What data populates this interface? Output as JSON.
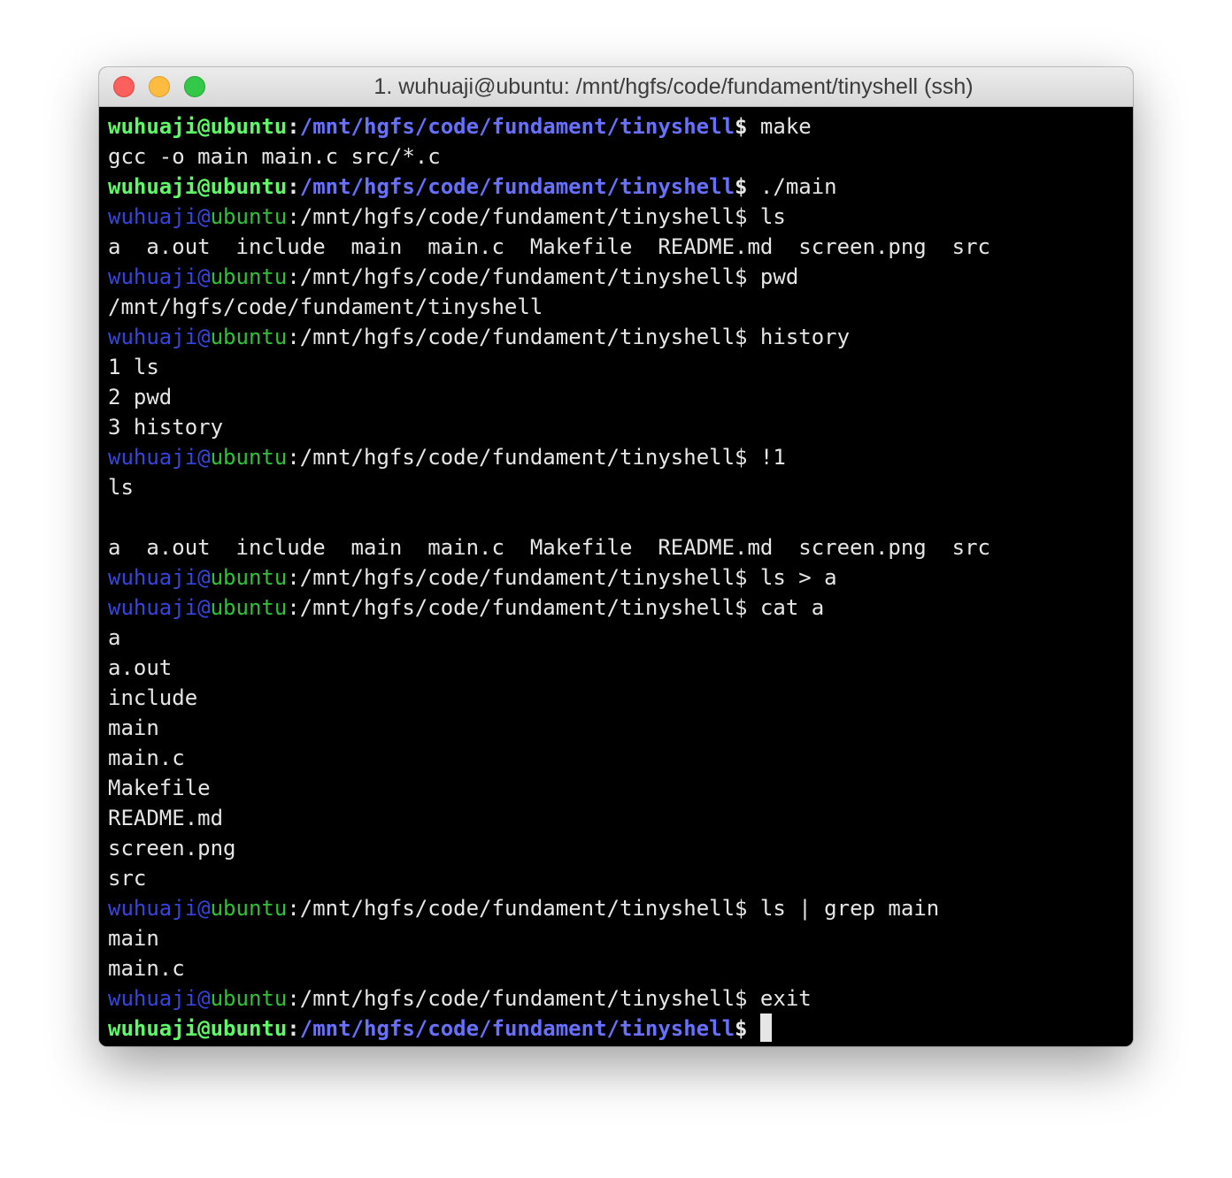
{
  "window": {
    "title": "1. wuhuaji@ubuntu: /mnt/hgfs/code/fundament/tinyshell (ssh)"
  },
  "colors": {
    "bold_user": "#5ff967",
    "bold_path": "#6871ff",
    "plain_user": "#3744e0",
    "plain_host": "#2fc238",
    "text": "#e6e6e6",
    "background": "#000000"
  },
  "terminal": {
    "lines": [
      {
        "type": "bold_prompt",
        "user": "wuhuaji@ubuntu",
        "path": "/mnt/hgfs/code/fundament/tinyshell",
        "cmd": " make"
      },
      {
        "type": "output",
        "text": "gcc -o main main.c src/*.c"
      },
      {
        "type": "bold_prompt",
        "user": "wuhuaji@ubuntu",
        "path": "/mnt/hgfs/code/fundament/tinyshell",
        "cmd": " ./main"
      },
      {
        "type": "plain_prompt",
        "user": "wuhuaji",
        "at": "@",
        "host": "ubuntu",
        "path": ":/mnt/hgfs/code/fundament/tinyshell$",
        "cmd": " ls"
      },
      {
        "type": "output",
        "text": "a  a.out  include  main  main.c  Makefile  README.md  screen.png  src"
      },
      {
        "type": "plain_prompt",
        "user": "wuhuaji",
        "at": "@",
        "host": "ubuntu",
        "path": ":/mnt/hgfs/code/fundament/tinyshell$",
        "cmd": " pwd"
      },
      {
        "type": "output",
        "text": "/mnt/hgfs/code/fundament/tinyshell"
      },
      {
        "type": "plain_prompt",
        "user": "wuhuaji",
        "at": "@",
        "host": "ubuntu",
        "path": ":/mnt/hgfs/code/fundament/tinyshell$",
        "cmd": " history"
      },
      {
        "type": "output",
        "text": "1 ls"
      },
      {
        "type": "output",
        "text": "2 pwd"
      },
      {
        "type": "output",
        "text": "3 history"
      },
      {
        "type": "plain_prompt",
        "user": "wuhuaji",
        "at": "@",
        "host": "ubuntu",
        "path": ":/mnt/hgfs/code/fundament/tinyshell$",
        "cmd": " !1"
      },
      {
        "type": "output",
        "text": "ls"
      },
      {
        "type": "output",
        "text": ""
      },
      {
        "type": "output",
        "text": "a  a.out  include  main  main.c  Makefile  README.md  screen.png  src"
      },
      {
        "type": "plain_prompt",
        "user": "wuhuaji",
        "at": "@",
        "host": "ubuntu",
        "path": ":/mnt/hgfs/code/fundament/tinyshell$",
        "cmd": " ls > a"
      },
      {
        "type": "plain_prompt",
        "user": "wuhuaji",
        "at": "@",
        "host": "ubuntu",
        "path": ":/mnt/hgfs/code/fundament/tinyshell$",
        "cmd": " cat a"
      },
      {
        "type": "output",
        "text": "a"
      },
      {
        "type": "output",
        "text": "a.out"
      },
      {
        "type": "output",
        "text": "include"
      },
      {
        "type": "output",
        "text": "main"
      },
      {
        "type": "output",
        "text": "main.c"
      },
      {
        "type": "output",
        "text": "Makefile"
      },
      {
        "type": "output",
        "text": "README.md"
      },
      {
        "type": "output",
        "text": "screen.png"
      },
      {
        "type": "output",
        "text": "src"
      },
      {
        "type": "plain_prompt",
        "user": "wuhuaji",
        "at": "@",
        "host": "ubuntu",
        "path": ":/mnt/hgfs/code/fundament/tinyshell$",
        "cmd": " ls | grep main"
      },
      {
        "type": "output",
        "text": "main"
      },
      {
        "type": "output",
        "text": "main.c"
      },
      {
        "type": "plain_prompt",
        "user": "wuhuaji",
        "at": "@",
        "host": "ubuntu",
        "path": ":/mnt/hgfs/code/fundament/tinyshell$",
        "cmd": " exit"
      },
      {
        "type": "bold_prompt_cursor",
        "user": "wuhuaji@ubuntu",
        "path": "/mnt/hgfs/code/fundament/tinyshell",
        "cmd": " "
      }
    ]
  }
}
